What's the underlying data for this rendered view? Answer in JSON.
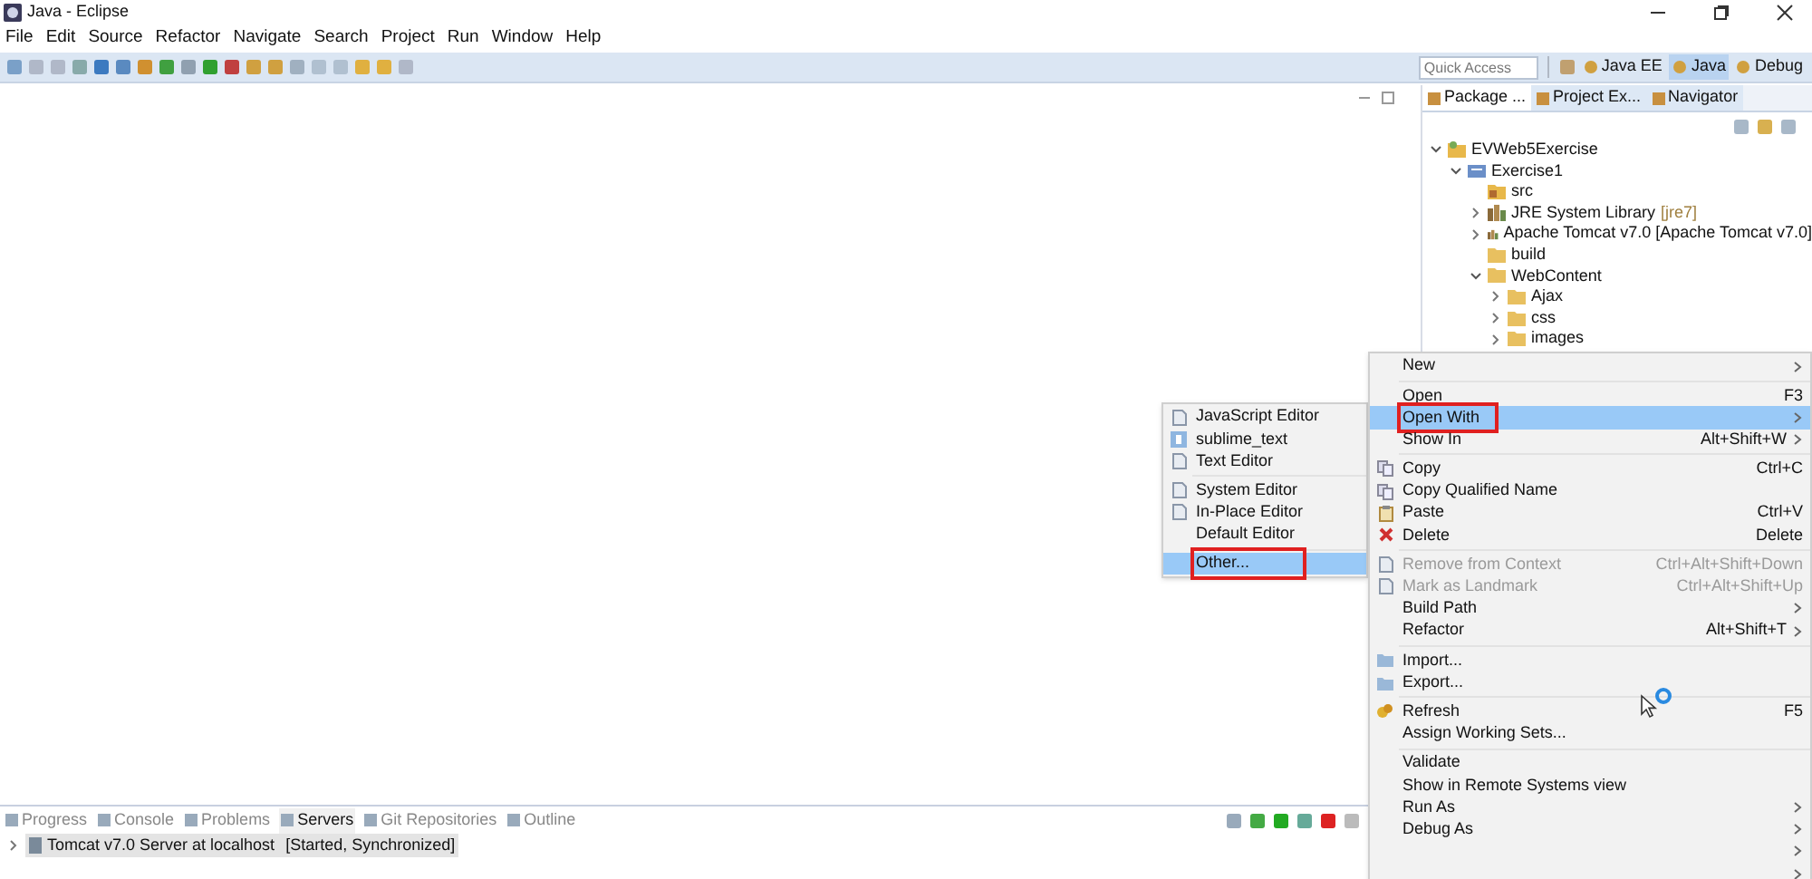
{
  "window": {
    "title": "Java - Eclipse"
  },
  "menu_bar": [
    "File",
    "Edit",
    "Source",
    "Refactor",
    "Navigate",
    "Search",
    "Project",
    "Run",
    "Window",
    "Help"
  ],
  "quick_access": {
    "placeholder": "Quick Access"
  },
  "perspectives": [
    {
      "label": "Java EE",
      "selected": false
    },
    {
      "label": "Java",
      "selected": true
    },
    {
      "label": "Debug",
      "selected": false
    }
  ],
  "explorer": {
    "tabs": [
      {
        "label": "Package ...",
        "selected": true
      },
      {
        "label": "Project Ex...",
        "selected": false
      },
      {
        "label": "Navigator",
        "selected": false
      }
    ],
    "tree": [
      {
        "label": "EVWeb5Exercise",
        "kind": "project",
        "expanded": true,
        "children": [
          {
            "label": "Exercise1",
            "kind": "module",
            "expanded": true,
            "children": [
              {
                "label": "src",
                "kind": "source"
              },
              {
                "label": "JRE System Library",
                "decoration": "[jre7]",
                "kind": "library",
                "expanded": false
              },
              {
                "label": "Apache Tomcat v7.0 [Apache Tomcat v7.0]",
                "kind": "library",
                "expanded": false
              },
              {
                "label": "build",
                "kind": "folder"
              },
              {
                "label": "WebContent",
                "kind": "folder",
                "expanded": true,
                "children": [
                  {
                    "label": "Ajax",
                    "kind": "folder",
                    "expanded": false
                  },
                  {
                    "label": "css",
                    "kind": "folder",
                    "expanded": false
                  },
                  {
                    "label": "images",
                    "kind": "folder",
                    "expanded": false
                  }
                ]
              }
            ]
          }
        ]
      }
    ]
  },
  "bottom_panel": {
    "tabs": [
      {
        "label": "Progress",
        "selected": false
      },
      {
        "label": "Console",
        "selected": false
      },
      {
        "label": "Problems",
        "selected": false
      },
      {
        "label": "Servers",
        "selected": true
      },
      {
        "label": "Git Repositories",
        "selected": false
      },
      {
        "label": "Outline",
        "selected": false
      }
    ],
    "servers": [
      {
        "label": "Tomcat v7.0 Server at localhost",
        "status": "[Started, Synchronized]",
        "selected": true
      }
    ]
  },
  "submenu": [
    {
      "kind": "page",
      "label": "JavaScript Editor",
      "selected": false,
      "outlined": false
    },
    {
      "kind": "app",
      "label": "sublime_text",
      "selected": false,
      "outlined": false
    },
    {
      "kind": "page",
      "label": "Text Editor",
      "selected": false,
      "outlined": false
    },
    {
      "kind": "separator"
    },
    {
      "kind": "page",
      "label": "System Editor",
      "selected": false,
      "outlined": false
    },
    {
      "kind": "page",
      "label": "In-Place Editor",
      "selected": false,
      "outlined": false
    },
    {
      "kind": "plain",
      "label": "Default Editor",
      "selected": false,
      "outlined": false
    },
    {
      "kind": "separator"
    },
    {
      "kind": "plain",
      "label": "Other...",
      "selected": true,
      "outlined": true
    }
  ],
  "context_menu": [
    {
      "kind": "plain",
      "label": "New",
      "submenu": true,
      "disabled": false,
      "selected": false,
      "outlined": false
    },
    {
      "kind": "separator"
    },
    {
      "kind": "plain",
      "label": "Open",
      "shortcut": "F3",
      "submenu": false,
      "disabled": false,
      "selected": false,
      "outlined": false
    },
    {
      "kind": "plain",
      "label": "Open With",
      "submenu": true,
      "disabled": false,
      "selected": true,
      "outlined": true
    },
    {
      "kind": "plain",
      "label": "Show In",
      "shortcut": "Alt+Shift+W",
      "submenu": true,
      "disabled": false,
      "selected": false,
      "outlined": false
    },
    {
      "kind": "separator"
    },
    {
      "kind": "copy",
      "label": "Copy",
      "shortcut": "Ctrl+C",
      "submenu": false,
      "disabled": false,
      "selected": false,
      "outlined": false
    },
    {
      "kind": "copy",
      "label": "Copy Qualified Name",
      "submenu": false,
      "disabled": false,
      "selected": false,
      "outlined": false
    },
    {
      "kind": "paste",
      "label": "Paste",
      "shortcut": "Ctrl+V",
      "submenu": false,
      "disabled": false,
      "selected": false,
      "outlined": false
    },
    {
      "kind": "delete",
      "label": "Delete",
      "shortcut": "Delete",
      "submenu": false,
      "disabled": false,
      "selected": false,
      "outlined": false
    },
    {
      "kind": "separator"
    },
    {
      "kind": "page",
      "label": "Remove from Context",
      "shortcut": "Ctrl+Alt+Shift+Down",
      "submenu": false,
      "disabled": true,
      "selected": false,
      "outlined": false
    },
    {
      "kind": "page",
      "label": "Mark as Landmark",
      "shortcut": "Ctrl+Alt+Shift+Up",
      "submenu": false,
      "disabled": true,
      "selected": false,
      "outlined": false
    },
    {
      "kind": "plain",
      "label": "Build Path",
      "submenu": true,
      "disabled": false,
      "selected": false,
      "outlined": false
    },
    {
      "kind": "plain",
      "label": "Refactor",
      "shortcut": "Alt+Shift+T",
      "submenu": true,
      "disabled": false,
      "selected": false,
      "outlined": false
    },
    {
      "kind": "separator"
    },
    {
      "kind": "folder",
      "label": "Import...",
      "submenu": false,
      "disabled": false,
      "selected": false,
      "outlined": false
    },
    {
      "kind": "folder",
      "label": "Export...",
      "submenu": false,
      "disabled": false,
      "selected": false,
      "outlined": false
    },
    {
      "kind": "separator"
    },
    {
      "kind": "refresh",
      "label": "Refresh",
      "shortcut": "F5",
      "submenu": false,
      "disabled": false,
      "selected": false,
      "outlined": false
    },
    {
      "kind": "plain",
      "label": "Assign Working Sets...",
      "submenu": false,
      "disabled": false,
      "selected": false,
      "outlined": false
    },
    {
      "kind": "separator"
    },
    {
      "kind": "plain",
      "label": "Validate",
      "submenu": false,
      "disabled": false,
      "selected": false,
      "outlined": false
    },
    {
      "kind": "plain",
      "label": "Show in Remote Systems view",
      "submenu": false,
      "disabled": false,
      "selected": false,
      "outlined": false
    },
    {
      "kind": "plain",
      "label": "Run As",
      "submenu": true,
      "disabled": false,
      "selected": false,
      "outlined": false
    },
    {
      "kind": "plain",
      "label": "Debug As",
      "submenu": true,
      "disabled": false,
      "selected": false,
      "outlined": false
    },
    {
      "kind": "plain",
      "submenu": true
    },
    {
      "kind": "plain",
      "submenu": true
    }
  ]
}
